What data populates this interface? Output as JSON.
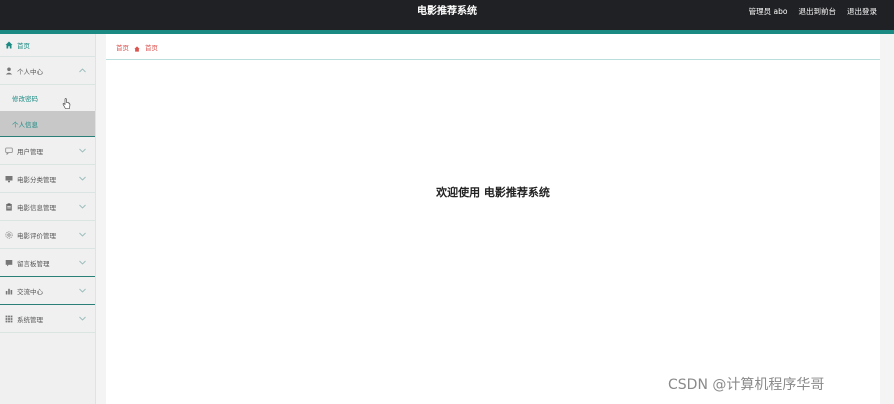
{
  "header": {
    "title": "电影推荐系统",
    "user_label": "管理员 abo",
    "exit_front_label": "退出到前台",
    "logout_label": "退出登录"
  },
  "sidebar": {
    "items": [
      {
        "label": "首页",
        "icon": "home-icon"
      },
      {
        "label": "个人中心",
        "icon": "user-icon",
        "expanded": true,
        "children": [
          {
            "label": "修改密码"
          },
          {
            "label": "个人信息",
            "active": true
          }
        ]
      },
      {
        "label": "用户管理",
        "icon": "chat-icon"
      },
      {
        "label": "电影分类管理",
        "icon": "monitor-icon"
      },
      {
        "label": "电影信息管理",
        "icon": "clipboard-icon"
      },
      {
        "label": "电影评价管理",
        "icon": "gear-icon"
      },
      {
        "label": "留言板管理",
        "icon": "message-icon"
      },
      {
        "label": "交流中心",
        "icon": "chart-icon"
      },
      {
        "label": "系统管理",
        "icon": "grid-icon"
      }
    ]
  },
  "breadcrumb": {
    "home_label": "首页",
    "current_label": "首页"
  },
  "main": {
    "welcome_text": "欢迎使用 电影推荐系统"
  },
  "watermark": "CSDN @计算机程序华哥",
  "colors": {
    "topbar": "#202124",
    "accent": "#1a8a83",
    "breadcrumb": "#d9534f"
  }
}
